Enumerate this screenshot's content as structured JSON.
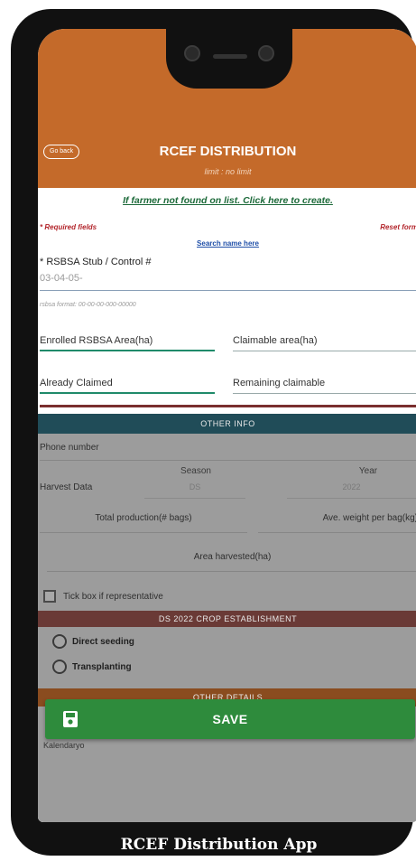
{
  "header": {
    "back_label": "Go back",
    "title": "RCEF DISTRIBUTION",
    "subtitle": "limit : no limit",
    "bg_color": "#c46a2a"
  },
  "form": {
    "create_link": "If farmer not found on list. Click here to create.",
    "required_note": "* Required fields",
    "reset_label": "Reset form",
    "search_link": "Search name here",
    "rsbsa_label": "* RSBSA Stub / Control #",
    "rsbsa_value": "03-04-05-",
    "rsbsa_hint": "rsbsa format: 00-00-00-000-00000",
    "enrolled_area": "Enrolled RSBSA Area(ha)",
    "claimable_area": "Claimable area(ha)",
    "already_claimed": "Already Claimed",
    "remaining_claimable": "Remaining claimable"
  },
  "other_info": {
    "title": "OTHER INFO",
    "phone_label": "Phone number",
    "harvest_label": "Harvest Data",
    "season_label": "Season",
    "season_value": "DS",
    "year_label": "Year",
    "year_value": "2022",
    "total_production": "Total production(# bags)",
    "ave_weight": "Ave. weight per bag(kg)",
    "area_harvested": "Area harvested(ha)",
    "tick_label": "Tick box if representative"
  },
  "crop_establishment": {
    "title": "DS 2022 CROP ESTABLISHMENT",
    "options": [
      "Direct seeding",
      "Transplanting"
    ]
  },
  "other_details": {
    "title": "OTHER DETAILS",
    "kalendaryo": "Kalendaryo"
  },
  "save_button": {
    "label": "SAVE",
    "icon": "floppy-disk-icon",
    "color": "#2e8b3c"
  },
  "caption": "RCEF Distribution App"
}
